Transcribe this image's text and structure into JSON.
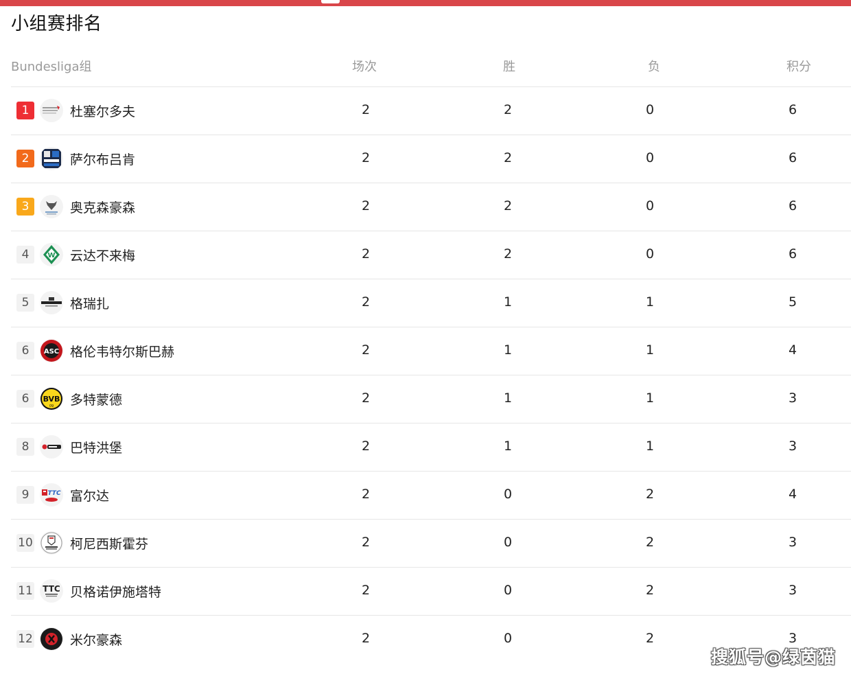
{
  "page_title": "小组赛排名",
  "table": {
    "group_label": "Bundesliga组",
    "columns": [
      "场次",
      "胜",
      "负",
      "积分"
    ],
    "rows": [
      {
        "rank": "1",
        "team": "杜塞尔多夫",
        "played": "2",
        "won": "2",
        "lost": "0",
        "points": "6",
        "logo": "borussia-duesseldorf-logo"
      },
      {
        "rank": "2",
        "team": "萨尔布吕肯",
        "played": "2",
        "won": "2",
        "lost": "0",
        "points": "6",
        "logo": "saarbruecken-logo"
      },
      {
        "rank": "3",
        "team": "奥克森豪森",
        "played": "2",
        "won": "2",
        "lost": "0",
        "points": "6",
        "logo": "ochsenhausen-logo"
      },
      {
        "rank": "4",
        "team": "云达不来梅",
        "played": "2",
        "won": "2",
        "lost": "0",
        "points": "6",
        "logo": "werder-bremen-logo"
      },
      {
        "rank": "5",
        "team": "格瑞扎",
        "played": "2",
        "won": "1",
        "lost": "1",
        "points": "5",
        "logo": "grenzau-logo"
      },
      {
        "rank": "6",
        "team": "格伦韦特尔斯巴赫",
        "played": "2",
        "won": "1",
        "lost": "1",
        "points": "4",
        "logo": "grunwettersbach-logo"
      },
      {
        "rank": "6",
        "team": "多特蒙德",
        "played": "2",
        "won": "1",
        "lost": "1",
        "points": "3",
        "logo": "bvb-logo"
      },
      {
        "rank": "8",
        "team": "巴特洪堡",
        "played": "2",
        "won": "1",
        "lost": "1",
        "points": "3",
        "logo": "bad-homburg-logo"
      },
      {
        "rank": "9",
        "team": "富尔达",
        "played": "2",
        "won": "0",
        "lost": "2",
        "points": "4",
        "logo": "fulda-logo"
      },
      {
        "rank": "10",
        "team": "柯尼西斯霍芬",
        "played": "2",
        "won": "0",
        "lost": "2",
        "points": "3",
        "logo": "koenigshofen-logo"
      },
      {
        "rank": "11",
        "team": "贝格诺伊施塔特",
        "played": "2",
        "won": "0",
        "lost": "2",
        "points": "3",
        "logo": "bergneustadt-logo"
      },
      {
        "rank": "12",
        "team": "米尔豪森",
        "played": "2",
        "won": "0",
        "lost": "2",
        "points": "3",
        "logo": "muehlhausen-logo"
      }
    ]
  },
  "watermark": "搜狐号@绿茵猫",
  "colors": {
    "top_bar": "#d9464a",
    "rank1": "#ee2e34",
    "rank2": "#f26a1b",
    "rank3": "#f9a81b"
  }
}
